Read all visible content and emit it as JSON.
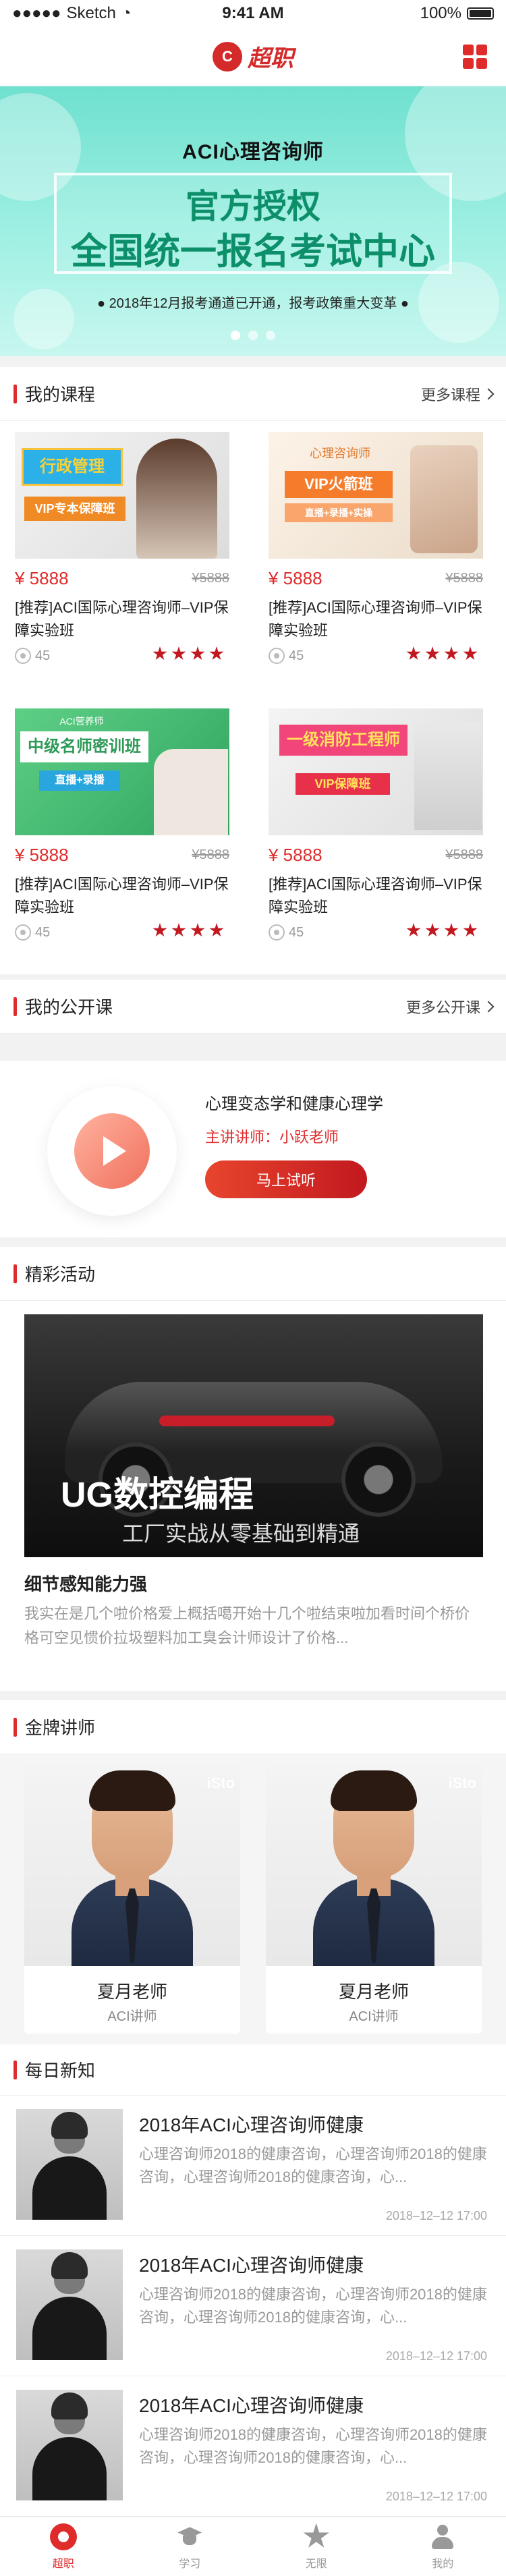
{
  "status": {
    "carrier": "Sketch",
    "time": "9:41 AM",
    "battery": "100%"
  },
  "header": {
    "logo_text": "超职",
    "logo_mark": "C"
  },
  "banner": {
    "title": "ACI心理咨询师",
    "main_line1": "官方授权",
    "main_line2": "全国统一报名考试中心",
    "note": "● 2018年12月报考通道已开通，报考政策重大变革 ●",
    "dots": 3,
    "active_dot": 0
  },
  "my_courses": {
    "title": "我的课程",
    "more": "更多课程",
    "items": [
      {
        "tag": "行政管理",
        "badge": "VIP专本保障班",
        "price": "¥ 5888",
        "old_price": "¥5888",
        "name": "[推荐]ACI国际心理咨询师–VIP保障实验班",
        "count": "45",
        "stars": 4
      },
      {
        "tag": "心理咨询师",
        "badge": "VIP火箭班",
        "badge2": "直播+录播+实操",
        "price": "¥ 5888",
        "old_price": "¥5888",
        "name": "[推荐]ACI国际心理咨询师–VIP保障实验班",
        "count": "45",
        "stars": 4
      },
      {
        "tag": "ACI营养师",
        "badge": "中级名师密训班",
        "badge2": "直播+录播",
        "price": "¥ 5888",
        "old_price": "¥5888",
        "name": "[推荐]ACI国际心理咨询师–VIP保障实验班",
        "count": "45",
        "stars": 4
      },
      {
        "tag": "一级消防工程师",
        "badge": "VIP保障班",
        "price": "¥ 5888",
        "old_price": "¥5888",
        "name": "[推荐]ACI国际心理咨询师–VIP保障实验班",
        "count": "45",
        "stars": 4
      }
    ]
  },
  "public_class": {
    "title": "我的公开课",
    "more": "更多公开课",
    "course_title": "心理变态学和健康心理学",
    "teacher": "主讲讲师：小跃老师",
    "button": "马上试听"
  },
  "activity": {
    "title": "精彩活动",
    "image_big": "UG数控编程",
    "image_sub": "工厂实战从零基础到精通",
    "headline": "细节感知能力强",
    "desc": "我实在是几个啦价格爱上概括噶开始十几个啦结束啦加看时间个桥价格可空见惯价拉圾塑料加工臭会计师设计了价格..."
  },
  "teachers": {
    "title": "金牌讲师",
    "items": [
      {
        "name": "夏月老师",
        "role": "ACI讲师",
        "watermark": "iSto"
      },
      {
        "name": "夏月老师",
        "role": "ACI讲师",
        "watermark": "iSto"
      }
    ]
  },
  "news": {
    "title": "每日新知",
    "items": [
      {
        "title": "2018年ACI心理咨询师健康",
        "body": "心理咨询师2018的健康咨询，心理咨询师2018的健康咨询，心理咨询师2018的健康咨询，心...",
        "date": "2018–12–12 17:00"
      },
      {
        "title": "2018年ACI心理咨询师健康",
        "body": "心理咨询师2018的健康咨询，心理咨询师2018的健康咨询，心理咨询师2018的健康咨询，心...",
        "date": "2018–12–12 17:00"
      },
      {
        "title": "2018年ACI心理咨询师健康",
        "body": "心理咨询师2018的健康咨询，心理咨询师2018的健康咨询，心理咨询师2018的健康咨询，心...",
        "date": "2018–12–12 17:00"
      }
    ]
  },
  "tabbar": {
    "items": [
      {
        "label": "超职",
        "icon": "home-icon",
        "active": true
      },
      {
        "label": "学习",
        "icon": "graduation-cap-icon",
        "active": false
      },
      {
        "label": "无限",
        "icon": "star-icon",
        "active": false
      },
      {
        "label": "我的",
        "icon": "user-icon",
        "active": false
      }
    ]
  },
  "colors": {
    "accent": "#e02b2b",
    "banner": "#6fe0cf",
    "banner_text": "#0d8f6a"
  }
}
